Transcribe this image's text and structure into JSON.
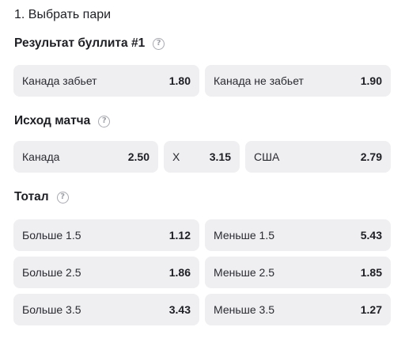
{
  "step_title": "1. Выбрать пари",
  "sections": [
    {
      "title": "Результат буллита #1",
      "info_icon": "question-circle-icon",
      "options": [
        {
          "label": "Канада забьет",
          "odds": "1.80"
        },
        {
          "label": "Канада не забьет",
          "odds": "1.90"
        }
      ]
    },
    {
      "title": "Исход матча",
      "info_icon": "question-circle-icon",
      "options": [
        {
          "label": "Канада",
          "odds": "2.50"
        },
        {
          "label": "X",
          "odds": "3.15"
        },
        {
          "label": "США",
          "odds": "2.79"
        }
      ]
    },
    {
      "title": "Тотал",
      "info_icon": "question-circle-icon",
      "options": [
        {
          "label": "Больше 1.5",
          "odds": "1.12"
        },
        {
          "label": "Меньше 1.5",
          "odds": "5.43"
        },
        {
          "label": "Больше 2.5",
          "odds": "1.86"
        },
        {
          "label": "Меньше 2.5",
          "odds": "1.85"
        },
        {
          "label": "Больше 3.5",
          "odds": "3.43"
        },
        {
          "label": "Меньше 3.5",
          "odds": "1.27"
        }
      ]
    }
  ],
  "colors": {
    "tile_background": "#efeff1",
    "text": "#1e1f24",
    "icon": "#a7a9b0"
  }
}
